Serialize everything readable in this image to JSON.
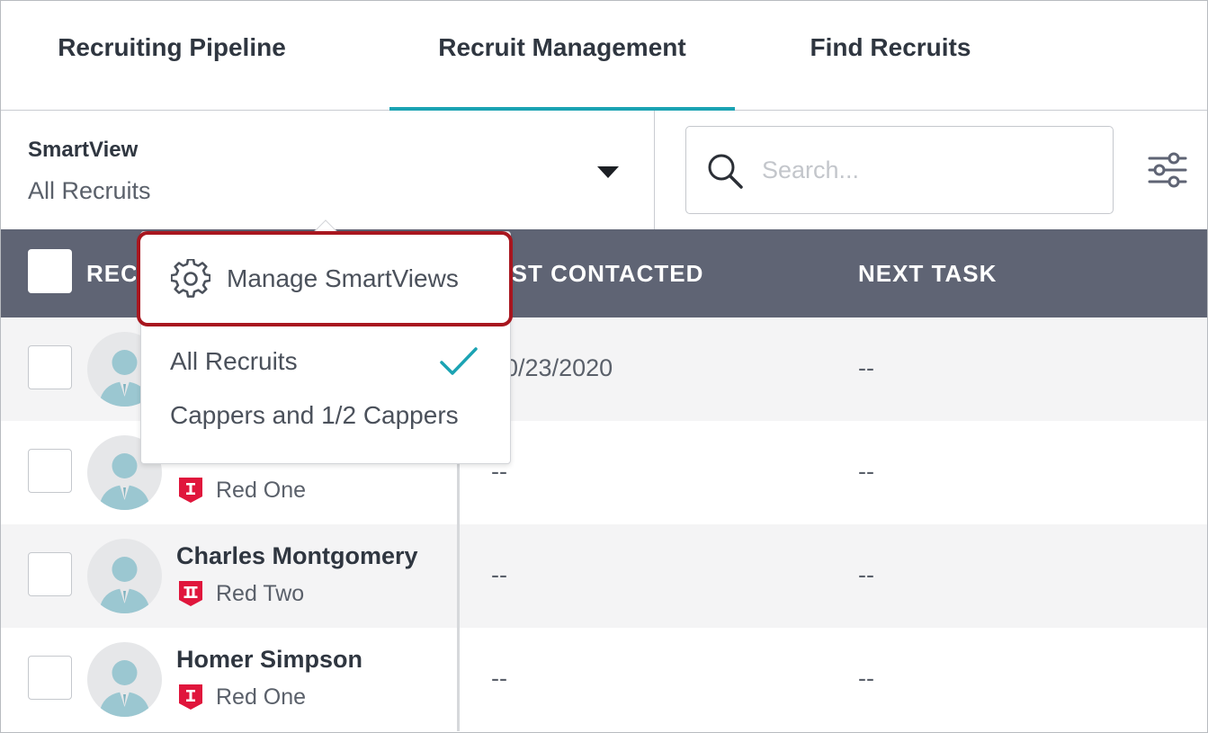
{
  "tabs": [
    {
      "label": "Recruiting Pipeline",
      "active": false
    },
    {
      "label": "Recruit Management",
      "active": true
    },
    {
      "label": "Find Recruits",
      "active": false
    }
  ],
  "accent_color": "#1ba3b3",
  "smartview": {
    "label": "SmartView",
    "selected": "All Recruits"
  },
  "search": {
    "placeholder": "Search..."
  },
  "table": {
    "headers": {
      "recruit": "RECRUIT",
      "last_contacted": "LAST CONTACTED",
      "next_task": "NEXT TASK"
    },
    "rows": [
      {
        "name": "",
        "level": "",
        "last_contacted": "10/23/2020",
        "next_task": "--"
      },
      {
        "name": "",
        "level": "Red One",
        "last_contacted": "--",
        "next_task": "--"
      },
      {
        "name": "Charles Montgomery",
        "level": "Red Two",
        "last_contacted": "--",
        "next_task": "--"
      },
      {
        "name": "Homer Simpson",
        "level": "Red One",
        "last_contacted": "--",
        "next_task": "--"
      }
    ]
  },
  "dropdown": {
    "manage_label": "Manage SmartViews",
    "items": [
      {
        "label": "All Recruits",
        "checked": true
      },
      {
        "label": "Cappers and 1/2 Cappers",
        "checked": false
      }
    ]
  },
  "highlight_color": "#a8161f",
  "badge_color": "#e0163c"
}
